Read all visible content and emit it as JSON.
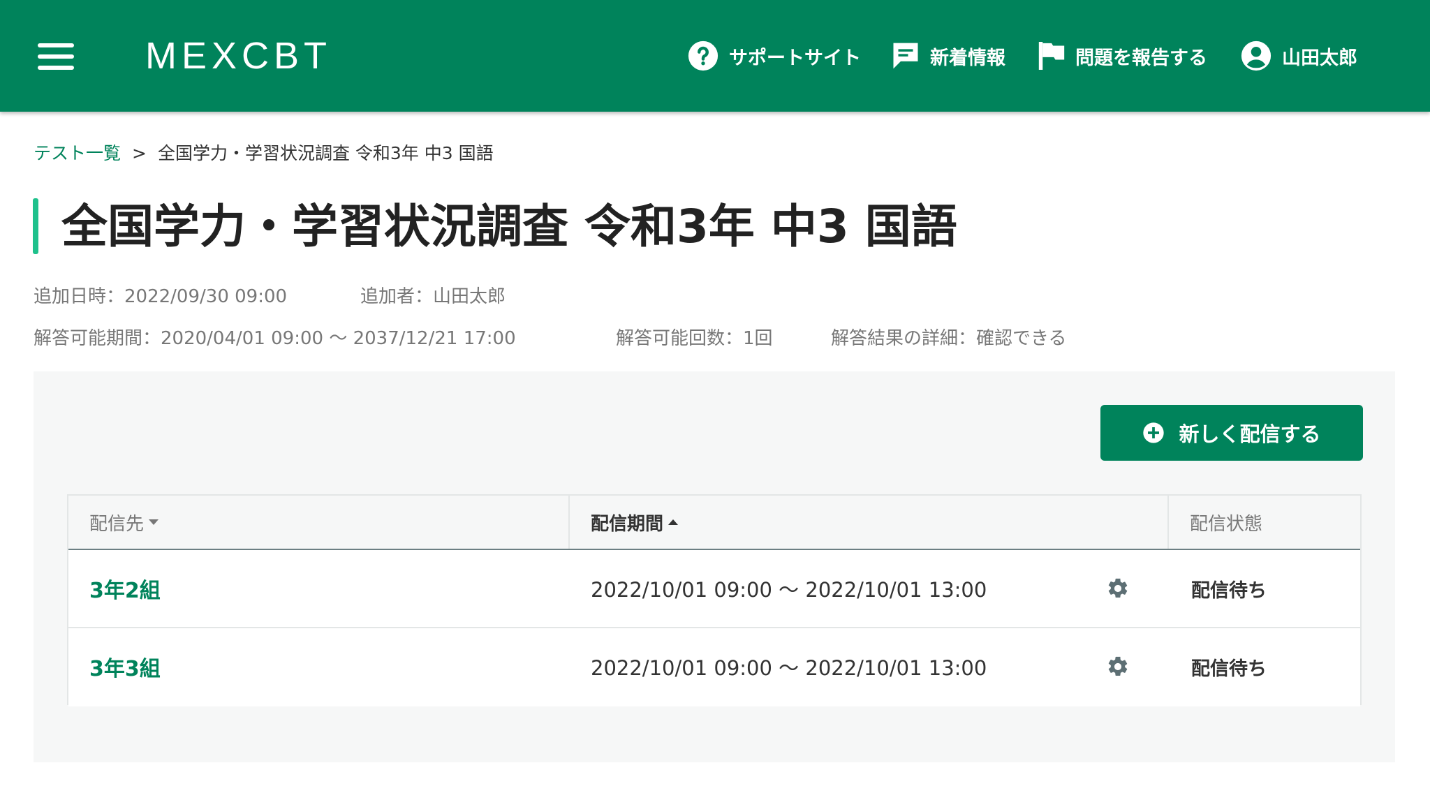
{
  "header": {
    "brand": "MEXCBT",
    "nav": {
      "support": "サポートサイト",
      "news": "新着情報",
      "report": "問題を報告する",
      "user": "山田太郎"
    }
  },
  "breadcrumb": {
    "parent": "テスト一覧",
    "separator": ">",
    "current": "全国学力・学習状況調査 令和3年 中3 国語"
  },
  "page_title": "全国学力・学習状況調査 令和3年 中3 国語",
  "meta": {
    "added_at": "追加日時：2022/09/30 09:00",
    "added_by": "追加者：山田太郎",
    "answer_period": "解答可能期間：2020/04/01 09:00 〜 2037/12/21 17:00",
    "answer_count": "解答可能回数：1回",
    "result_detail": "解答結果の詳細：確認できる"
  },
  "actions": {
    "new_delivery": "新しく配信する"
  },
  "table": {
    "columns": {
      "destination": "配信先",
      "period": "配信期間",
      "status": "配信状態"
    },
    "rows": [
      {
        "destination": "3年2組",
        "period": "2022/10/01 09:00 〜 2022/10/01 13:00",
        "status": "配信待ち"
      },
      {
        "destination": "3年3組",
        "period": "2022/10/01 09:00 〜 2022/10/01 13:00",
        "status": "配信待ち"
      }
    ]
  },
  "colors": {
    "brand_green": "#00835b",
    "accent_green": "#1fc18c",
    "panel_bg": "#f6f7f7"
  },
  "icons": {
    "menu": "hamburger-menu-icon",
    "support": "help-circle-icon",
    "news": "message-icon",
    "report": "flag-icon",
    "user": "account-circle-icon",
    "add": "plus-circle-icon",
    "settings": "gear-icon",
    "sort_desc": "caret-down-icon",
    "sort_asc": "caret-up-icon"
  }
}
